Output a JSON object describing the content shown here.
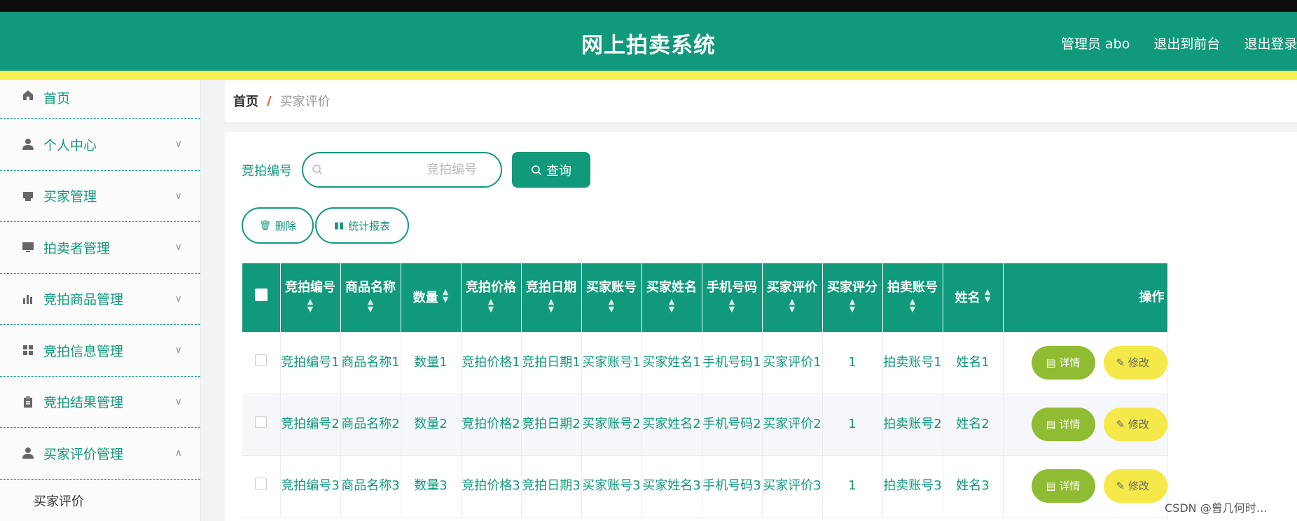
{
  "header": {
    "title": "网上拍卖系统",
    "admin_label": "管理员 abo",
    "front_label": "退出到前台",
    "logout_label": "退出登录"
  },
  "sidebar": {
    "items": [
      {
        "label": "首页",
        "icon": "home-icon"
      },
      {
        "label": "个人中心",
        "icon": "user-icon"
      },
      {
        "label": "买家管理",
        "icon": "printer-icon"
      },
      {
        "label": "拍卖者管理",
        "icon": "monitor-icon"
      },
      {
        "label": "竞拍商品管理",
        "icon": "bar-chart-icon"
      },
      {
        "label": "竞拍信息管理",
        "icon": "grid-icon"
      },
      {
        "label": "竞拍结果管理",
        "icon": "clipboard-icon"
      },
      {
        "label": "买家评价管理",
        "icon": "user-icon"
      }
    ],
    "submenu": "买家评价"
  },
  "breadcrumb": {
    "home": "首页",
    "separator": "/",
    "current": "买家评价"
  },
  "search": {
    "label": "竞拍编号",
    "placeholder": "竞拍编号",
    "button": "查询"
  },
  "actions": {
    "delete": "删除",
    "report": "统计报表"
  },
  "table": {
    "columns": [
      "竞拍编号",
      "商品名称",
      "数量",
      "竞拍价格",
      "竞拍日期",
      "买家账号",
      "买家姓名",
      "手机号码",
      "买家评价",
      "买家评分",
      "拍卖账号",
      "姓名"
    ],
    "ops_header": "操作",
    "detail_label": "详情",
    "edit_label": "修改",
    "rows": [
      [
        "竞拍编号1",
        "商品名称1",
        "数量1",
        "竞拍价格1",
        "竞拍日期1",
        "买家账号1",
        "买家姓名1",
        "手机号码1",
        "买家评价1",
        "1",
        "拍卖账号1",
        "姓名1"
      ],
      [
        "竞拍编号2",
        "商品名称2",
        "数量2",
        "竞拍价格2",
        "竞拍日期2",
        "买家账号2",
        "买家姓名2",
        "手机号码2",
        "买家评价2",
        "1",
        "拍卖账号2",
        "姓名2"
      ],
      [
        "竞拍编号3",
        "商品名称3",
        "数量3",
        "竞拍价格3",
        "竞拍日期3",
        "买家账号3",
        "买家姓名3",
        "手机号码3",
        "买家评价3",
        "1",
        "拍卖账号3",
        "姓名3"
      ]
    ]
  },
  "watermark": "CSDN @曾几何时…",
  "colors": {
    "primary": "#11997b",
    "accent_bar": "#f3ef55",
    "detail": "#8fbc33",
    "edit": "#f5e94a"
  }
}
